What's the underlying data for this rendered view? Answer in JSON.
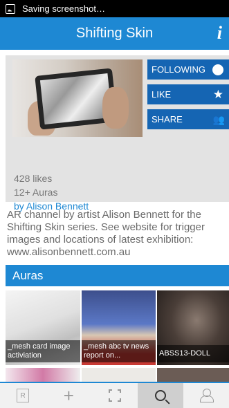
{
  "status_bar": {
    "text": "Saving screenshot…",
    "icon": "image-icon"
  },
  "header": {
    "title": "Shifting Skin",
    "info_icon": "info-icon",
    "color": "#1e88d3"
  },
  "channel": {
    "buttons": {
      "following": "FOLLOWING",
      "like": "LIKE",
      "share": "SHARE"
    },
    "likes": "428 likes",
    "auras_count": "12+ Auras",
    "author": "by Alison Bennett",
    "button_color": "#1565b3"
  },
  "description": "AR channel by artist Alison Bennett for the Shifting Skin series. See website for trigger images and locations of latest exhibition: www.alisonbennett.com.au",
  "auras": {
    "title": "Auras",
    "items": [
      {
        "caption": "_mesh card image activiation"
      },
      {
        "caption": "_mesh abc tv news report on..."
      },
      {
        "caption": "ABSS13-DOLL"
      }
    ]
  },
  "bottom_nav": {
    "items": [
      {
        "name": "ar-scan",
        "icon": "ar-icon"
      },
      {
        "name": "add",
        "icon": "plus-icon"
      },
      {
        "name": "scan-frame",
        "icon": "frame-icon"
      },
      {
        "name": "search",
        "icon": "search-icon",
        "active": true
      },
      {
        "name": "profile",
        "icon": "user-icon"
      }
    ]
  }
}
